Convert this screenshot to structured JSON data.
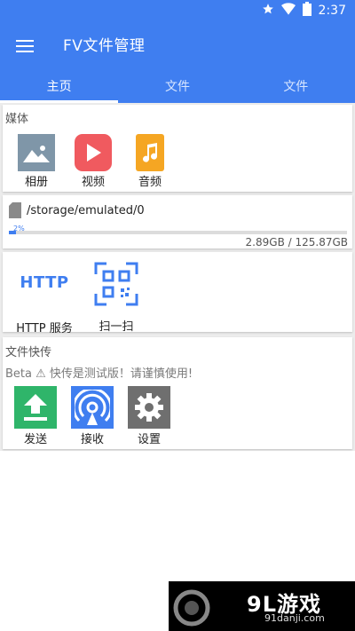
{
  "status_bar": {
    "time": "2:37",
    "icons": [
      "star-icon",
      "wifi-icon",
      "battery-icon"
    ]
  },
  "app_bar": {
    "title": "FV文件管理"
  },
  "tabs": [
    {
      "label": "主页",
      "active": true
    },
    {
      "label": "文件",
      "active": false
    },
    {
      "label": "文件",
      "active": false
    }
  ],
  "media_section": {
    "title": "媒体",
    "items": [
      {
        "label": "相册",
        "icon": "gallery-icon"
      },
      {
        "label": "视频",
        "icon": "video-icon"
      },
      {
        "label": "音频",
        "icon": "audio-icon"
      }
    ]
  },
  "storage": {
    "path": "/storage/emulated/0",
    "used_percent": 2,
    "percent_label": "2%",
    "size_text": "2.89GB / 125.87GB"
  },
  "tools_section": {
    "items": [
      {
        "label": "HTTP 服务",
        "icon": "http-icon"
      },
      {
        "label": "扫一扫",
        "icon": "qr-scan-icon"
      }
    ],
    "http_glyph": "HTTP"
  },
  "transfer_section": {
    "title": "文件快传",
    "beta_notice": "Beta ⚠ 快传是测试版！请谨慎使用!",
    "items": [
      {
        "label": "发送",
        "icon": "upload-icon"
      },
      {
        "label": "接收",
        "icon": "receive-icon"
      },
      {
        "label": "设置",
        "icon": "settings-icon"
      }
    ]
  },
  "watermark": {
    "logo_text": "9L游戏",
    "url": "91danji.com"
  },
  "colors": {
    "primary": "#3f7ef0",
    "gallery": "#7f96a8",
    "video": "#f05a5f",
    "audio": "#f5a623",
    "upload": "#2fb56a",
    "receive": "#3f7ef0",
    "settings": "#6f6f6f"
  }
}
